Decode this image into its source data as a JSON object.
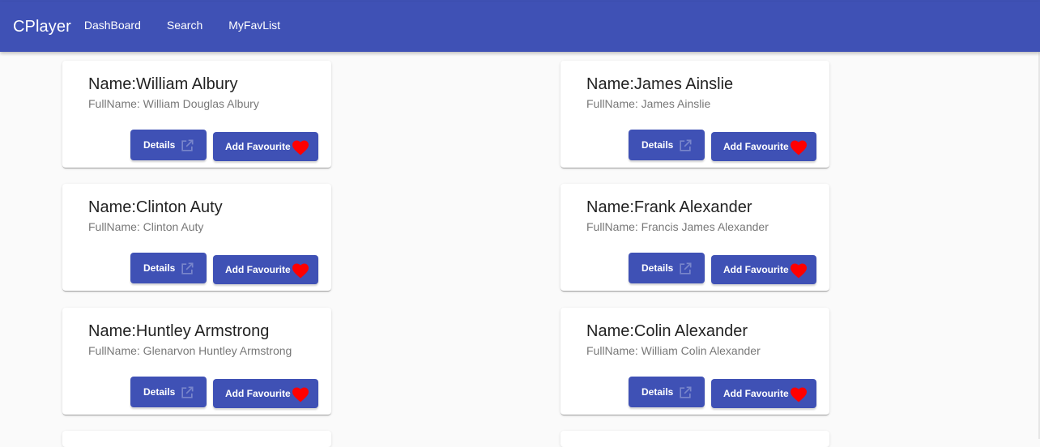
{
  "app": {
    "brand": "CPlayer",
    "nav": [
      "DashBoard",
      "Search",
      "MyFavList"
    ]
  },
  "cards": [
    {
      "name": "Name:William Albury",
      "fullname": "FullName: William Douglas Albury",
      "details_label": "Details",
      "fav_label": "Add Favourite"
    },
    {
      "name": "Name:James Ainslie",
      "fullname": "FullName: James Ainslie",
      "details_label": "Details",
      "fav_label": "Add Favourite"
    },
    {
      "name": "Name:Clinton Auty",
      "fullname": "FullName: Clinton Auty",
      "details_label": "Details",
      "fav_label": "Add Favourite"
    },
    {
      "name": "Name:Frank Alexander",
      "fullname": "FullName: Francis James Alexander",
      "details_label": "Details",
      "fav_label": "Add Favourite"
    },
    {
      "name": "Name:Huntley Armstrong",
      "fullname": "FullName: Glenarvon Huntley Armstrong",
      "details_label": "Details",
      "fav_label": "Add Favourite"
    },
    {
      "name": "Name:Colin Alexander",
      "fullname": "FullName: William Colin Alexander",
      "details_label": "Details",
      "fav_label": "Add Favourite"
    }
  ],
  "icons": {
    "details": "open-in-new-icon",
    "favourite": "heart-icon"
  },
  "colors": {
    "primary": "#3f51b5",
    "heart": "#ff0000",
    "background": "#fafafa"
  }
}
